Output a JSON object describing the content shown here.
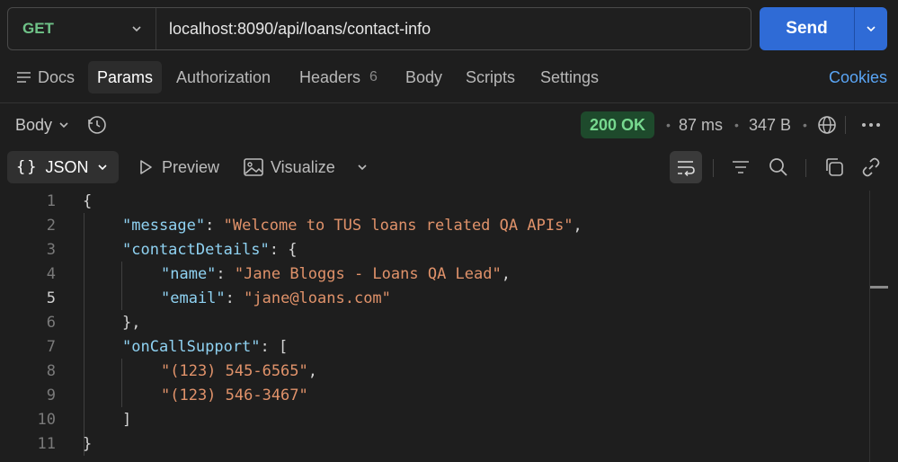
{
  "request": {
    "method": "GET",
    "url": "localhost:8090/api/loans/contact-info",
    "send_label": "Send"
  },
  "tabs": [
    {
      "label": "Docs",
      "icon": "docs-icon"
    },
    {
      "label": "Params",
      "active": true
    },
    {
      "label": "Authorization"
    },
    {
      "label": "Headers",
      "count": "6"
    },
    {
      "label": "Body"
    },
    {
      "label": "Scripts"
    },
    {
      "label": "Settings"
    }
  ],
  "cookies_label": "Cookies",
  "response": {
    "body_label": "Body",
    "status": "200 OK",
    "time": "87 ms",
    "size": "347 B",
    "status_color": "#77d98f"
  },
  "toolbar": {
    "format": "JSON",
    "format_prefix": "{}",
    "preview": "Preview",
    "visualize": "Visualize"
  },
  "code": {
    "line_numbers": [
      "1",
      "2",
      "3",
      "4",
      "5",
      "6",
      "7",
      "8",
      "9",
      "10",
      "11"
    ],
    "lines": [
      "{",
      "\"message\": \"Welcome to TUS loans related QA APIs\",",
      "\"contactDetails\": {",
      "\"name\": \"Jane Bloggs - Loans QA Lead\",",
      "\"email\": \"jane@loans.com\"",
      "},",
      "\"onCallSupport\": [",
      "\"(123) 545-6565\",",
      "\"(123) 546-3467\"",
      "]",
      "}"
    ],
    "tokens": {
      "l2_key": "\"message\"",
      "l2_val": "\"Welcome to TUS loans related QA APIs\"",
      "l3_key": "\"contactDetails\"",
      "l4_key": "\"name\"",
      "l4_val": "\"Jane Bloggs - Loans QA Lead\"",
      "l5_key": "\"email\"",
      "l5_val": "\"jane@loans.com\"",
      "l7_key": "\"onCallSupport\"",
      "l8_val": "\"(123) 545-6565\"",
      "l9_val": "\"(123) 546-3467\""
    }
  },
  "colors": {
    "accent": "#2f6bd6",
    "method": "#6fc388",
    "link": "#5aa5f5",
    "json_key": "#8fd2f2",
    "json_string": "#e0926a"
  }
}
